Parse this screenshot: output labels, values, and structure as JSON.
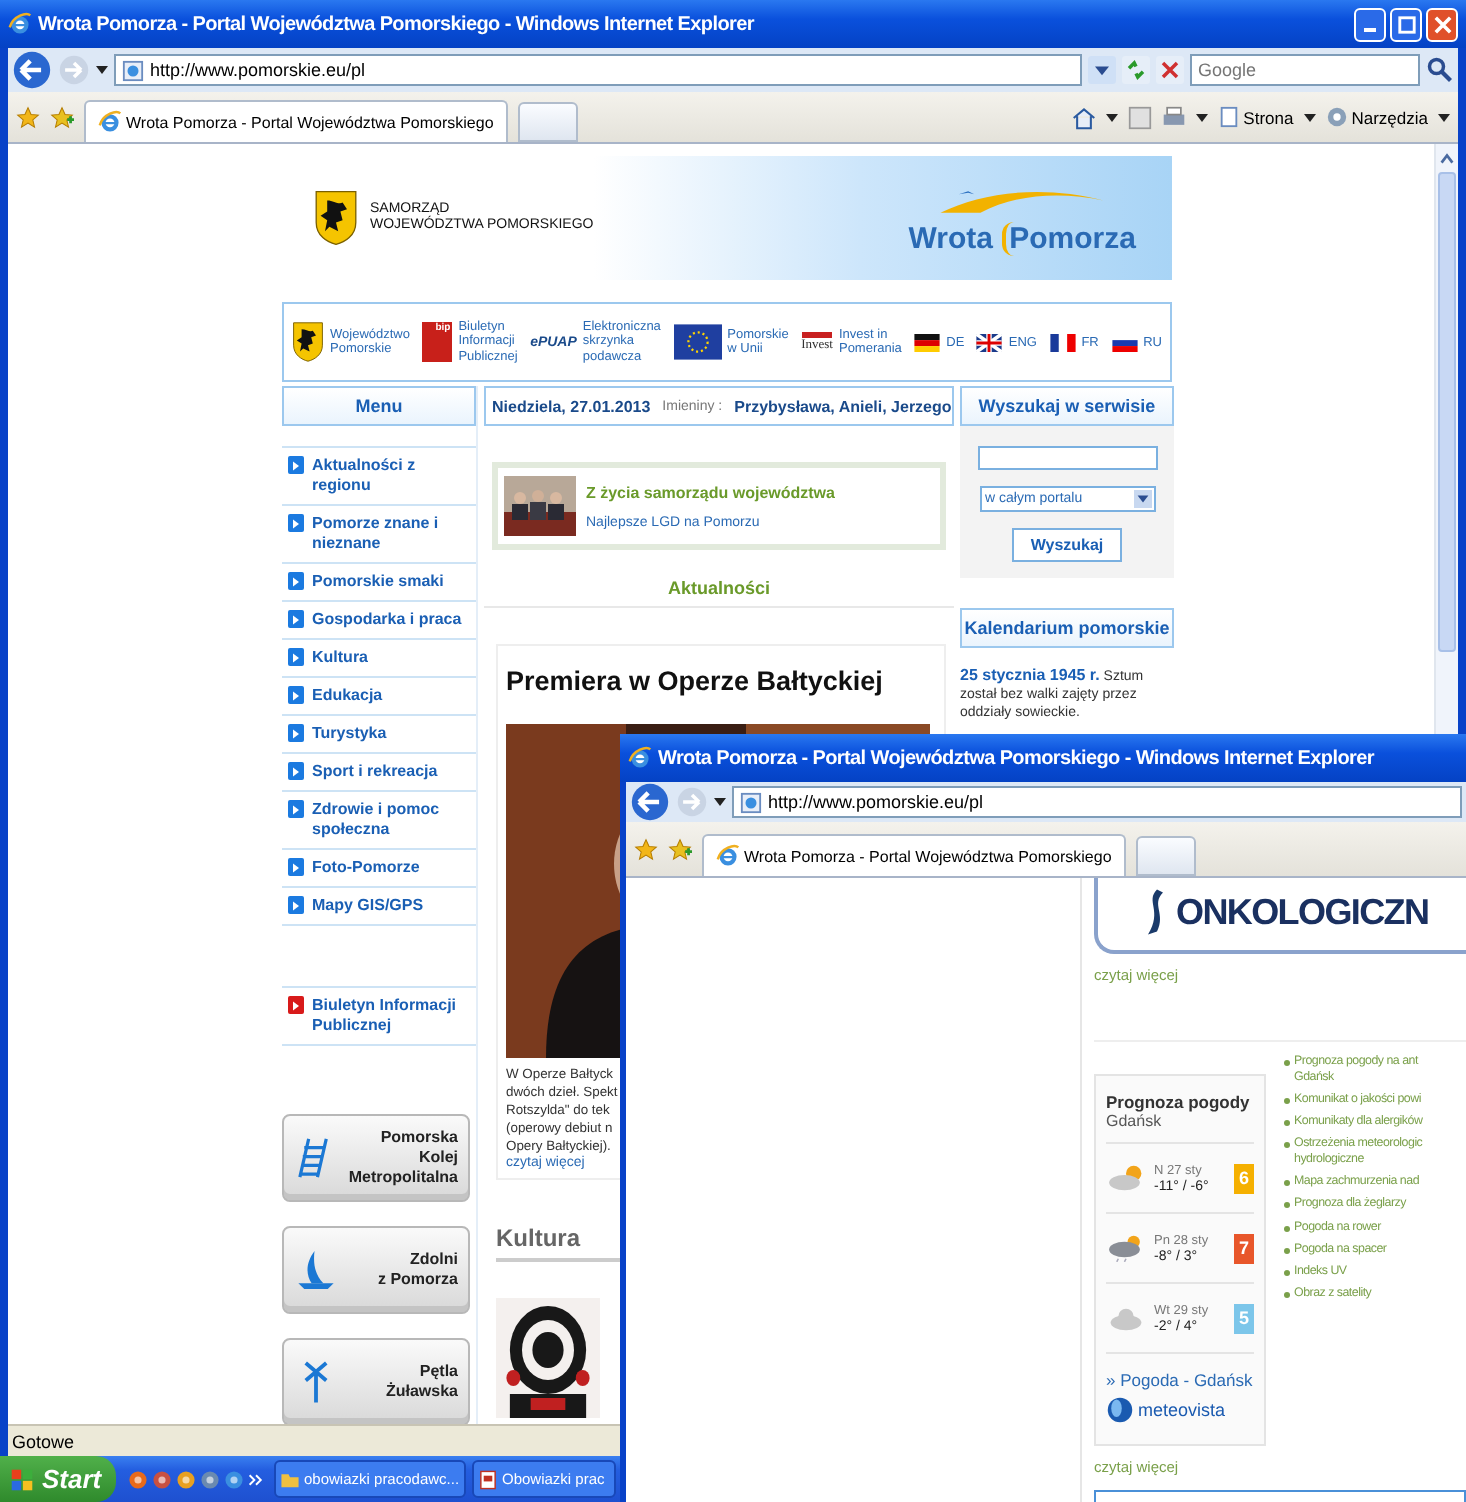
{
  "main_window": {
    "title": "Wrota Pomorza - Portal Województwa Pomorskiego - Windows Internet Explorer",
    "address": "http://www.pomorskie.eu/pl",
    "search_placeholder": "Google",
    "tab": {
      "label": "Wrota Pomorza - Portal Województwa Pomorskiego",
      "selected": true
    },
    "commands": [
      "Strona",
      "Narzędzia"
    ],
    "status": "Gotowe"
  },
  "page": {
    "header": {
      "org": [
        "SAMORZĄD",
        "WOJEWÓDZTWA POMORSKIEGO"
      ],
      "logo": [
        "Wrota",
        "Pomorza"
      ]
    },
    "partner_links": [
      {
        "kind": "crest",
        "lines": [
          "Województwo",
          "Pomorskie"
        ]
      },
      {
        "kind": "bip",
        "logo_text": "bip",
        "lines": [
          "Biuletyn",
          "Informacji",
          "Publicznej"
        ]
      },
      {
        "kind": "epuap",
        "logo_text": "ePUAP",
        "lines": [
          "Elektroniczna",
          "skrzynka",
          "podawcza"
        ]
      },
      {
        "kind": "eu",
        "lines": [
          "Pomorskie",
          "w Unii"
        ]
      },
      {
        "kind": "invest",
        "logo_text": "Invest",
        "lines": [
          "Invest in",
          "Pomerania"
        ]
      }
    ],
    "languages": [
      {
        "kind": "de",
        "code": "DE"
      },
      {
        "kind": "gb",
        "code": "ENG"
      },
      {
        "kind": "fr",
        "code": "FR"
      },
      {
        "kind": "ru",
        "code": "RU"
      }
    ],
    "menu": {
      "title": "Menu",
      "items": [
        {
          "kind": "section",
          "label": "Aktualności z regionu"
        },
        {
          "kind": "section",
          "label": "Pomorze znane i nieznane"
        },
        {
          "kind": "section",
          "label": "Pomorskie smaki"
        },
        {
          "kind": "section",
          "label": "Gospodarka i praca"
        },
        {
          "kind": "section",
          "label": "Kultura"
        },
        {
          "kind": "section",
          "label": "Edukacja"
        },
        {
          "kind": "section",
          "label": "Turystyka"
        },
        {
          "kind": "section",
          "label": "Sport i rekreacja"
        },
        {
          "kind": "section",
          "label": "Zdrowie i pomoc społeczna"
        },
        {
          "kind": "section",
          "label": "Foto-Pomorze"
        },
        {
          "kind": "section",
          "label": "Mapy GIS/GPS"
        },
        {
          "kind": "bip",
          "label": "Biuletyn Informacji Publicznej"
        }
      ]
    },
    "banners": [
      {
        "kind": "rail",
        "lines": [
          "Pomorska",
          "Kolej",
          "Metropolitalna"
        ]
      },
      {
        "kind": "boat",
        "lines": [
          "Zdolni",
          "z Pomorza"
        ]
      },
      {
        "kind": "cross",
        "lines": [
          "Pętla",
          "Żuławska"
        ]
      }
    ],
    "date_bar": {
      "date": "Niedziela, 27.01.2013",
      "names_label": "Imieniny :",
      "names": "Przybysława, Anieli, Jerzego"
    },
    "featured": {
      "title": "Z życia samorządu województwa",
      "link": "Najlepsze LGD na Pomorzu"
    },
    "news_heading": "Aktualności",
    "article": {
      "title": "Premiera w Operze Bałtyckiej",
      "caption": [
        "W Operze Bałtyck",
        "dwóch dzieł. Spekt",
        "Rotszylda\" do tek",
        "(operowy debiut n",
        "Opery Bałtyckiej)."
      ],
      "read_more": "czytaj więcej"
    },
    "culture_heading": "Kultura",
    "search": {
      "heading": "Wyszukaj w serwisie",
      "scope": "w całym portalu",
      "button": "Wyszukaj"
    },
    "calendar": {
      "heading": "Kalendarium pomorskie",
      "entry": "**25 stycznia 1945 r.** Sztum został bez walki zajęty przez oddziały sowieckie."
    }
  },
  "second_window": {
    "title": "Wrota Pomorza - Portal Województwa Pomorskiego - Windows Internet Explorer",
    "address": "http://www.pomorskie.eu/pl",
    "tab": {
      "label": "Wrota Pomorza - Portal Województwa Pomorskiego",
      "selected": true
    },
    "banner": "ONKOLOGICZN",
    "read_more": [
      "czytaj więcej",
      "czytaj więcej"
    ],
    "weather": {
      "title": "Prognoza pogody",
      "city": "Gdańsk",
      "days": [
        {
          "kind": "sun_cloud",
          "day": "N 27 sty",
          "temps": "-11° / -6°",
          "index": "6",
          "color": "#f5b000"
        },
        {
          "kind": "rain_cloud",
          "day": "Pn 28 sty",
          "temps": "-8° / 3°",
          "index": "7",
          "color": "#e8562a"
        },
        {
          "kind": "cloud",
          "day": "Wt 29 sty",
          "temps": "-2° / 4°",
          "index": "5",
          "color": "#7cc6ea"
        }
      ],
      "link": "» Pogoda - Gdańsk",
      "brand": "meteovista"
    },
    "links": [
      [
        "Prognoza pogody na ant",
        "Gdańsk"
      ],
      [
        "Komunikat o jakości powi"
      ],
      [
        "Komunikaty dla alergików"
      ],
      [
        "Ostrzeżenia meteorologic",
        "hydrologiczne"
      ],
      [
        "Mapa zachmurzenia nad"
      ],
      [
        "Prognoza dla żeglarzy"
      ],
      [
        "Pogoda na rower"
      ],
      [
        "Pogoda na spacer"
      ],
      [
        "Indeks UV"
      ],
      [
        "Obraz z satelity"
      ]
    ]
  },
  "taskbar": {
    "start": "Start",
    "tasks": [
      {
        "kind": "folder",
        "label": "obowiazki pracodawc..."
      },
      {
        "kind": "document",
        "label": "Obowiazki prac"
      }
    ]
  }
}
